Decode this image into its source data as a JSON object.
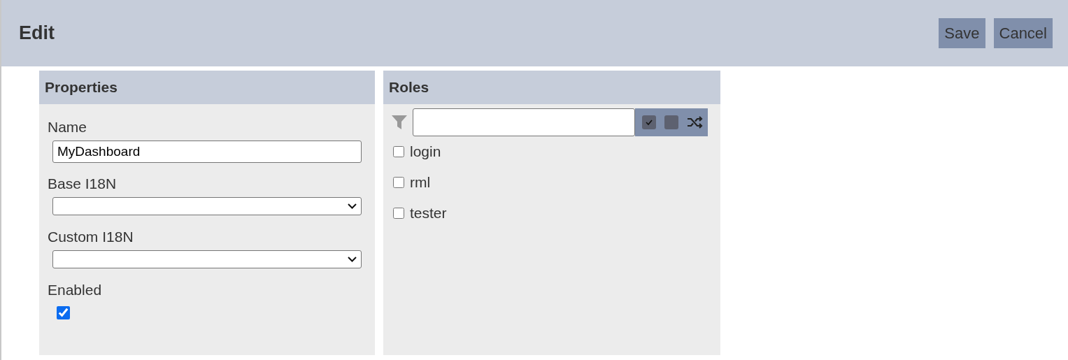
{
  "header": {
    "title": "Edit",
    "buttons": [
      "Save",
      "Cancel"
    ]
  },
  "properties": {
    "title": "Properties",
    "fields": [
      {
        "kind": "text",
        "label": "Name",
        "value": "MyDashboard"
      },
      {
        "kind": "select",
        "label": "Base I18N"
      },
      {
        "kind": "select",
        "label": "Custom I18N"
      },
      {
        "kind": "checkbox",
        "label": "Enabled",
        "checked": true
      }
    ]
  },
  "roles": {
    "title": "Roles",
    "items": [
      {
        "label": "login",
        "checked": false
      },
      {
        "label": "rml",
        "checked": false
      },
      {
        "label": "tester",
        "checked": false
      }
    ]
  }
}
